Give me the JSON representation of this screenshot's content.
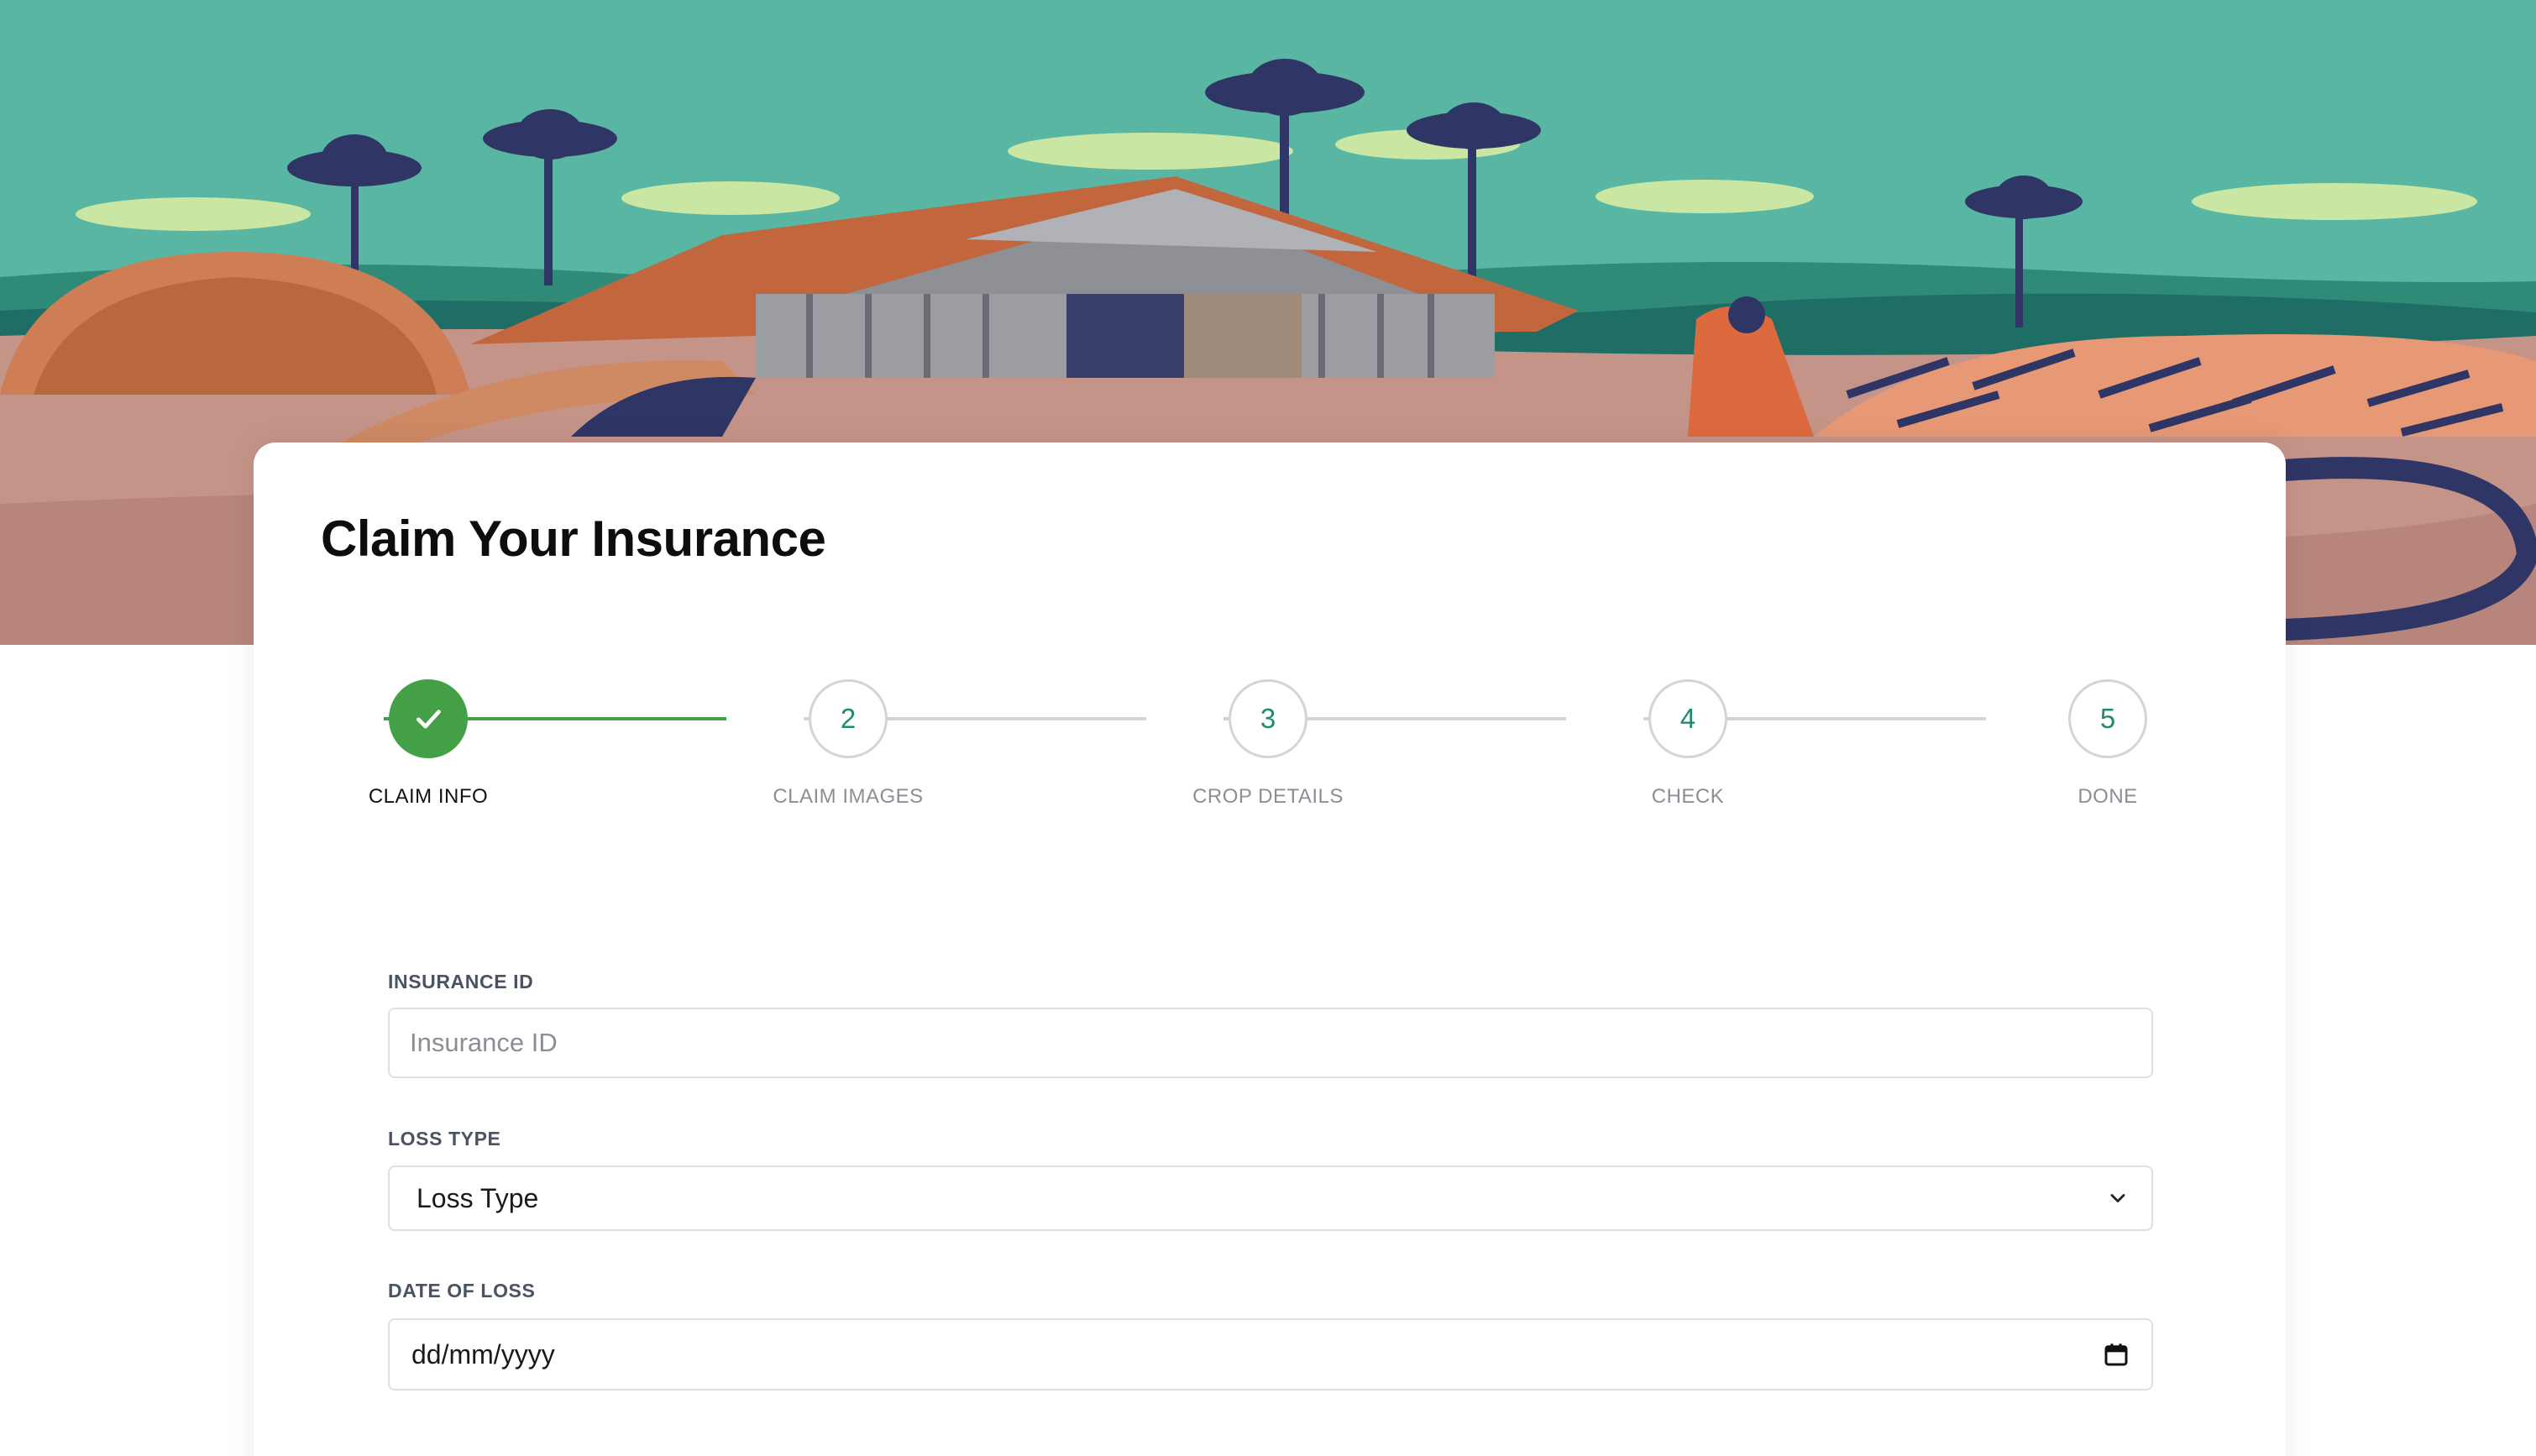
{
  "page": {
    "title": "Claim Your Insurance"
  },
  "stepper": {
    "current_step": 1,
    "steps": [
      {
        "label": "CLAIM INFO",
        "number": "1",
        "status": "completed",
        "icon": "check-icon"
      },
      {
        "label": "CLAIM IMAGES",
        "number": "2",
        "status": "pending"
      },
      {
        "label": "CROP DETAILS",
        "number": "3",
        "status": "pending"
      },
      {
        "label": "CHECK",
        "number": "4",
        "status": "pending"
      },
      {
        "label": "DONE",
        "number": "5",
        "status": "pending"
      }
    ]
  },
  "form": {
    "insurance_id": {
      "label": "INSURANCE ID",
      "placeholder": "Insurance ID",
      "value": ""
    },
    "loss_type": {
      "label": "LOSS TYPE",
      "selected": "Loss Type",
      "icon": "chevron-down-icon"
    },
    "date_of_loss": {
      "label": "DATE OF LOSS",
      "value": "dd/mm/yyyy",
      "icon": "calendar-icon"
    }
  },
  "colors": {
    "accent_green": "#43a047",
    "step_number_teal": "#1f8a70",
    "sky_teal": "#58b6a2",
    "ground": "#c59489",
    "inactive_line": "#d4d4d4",
    "label_grey": "#4a5361"
  }
}
